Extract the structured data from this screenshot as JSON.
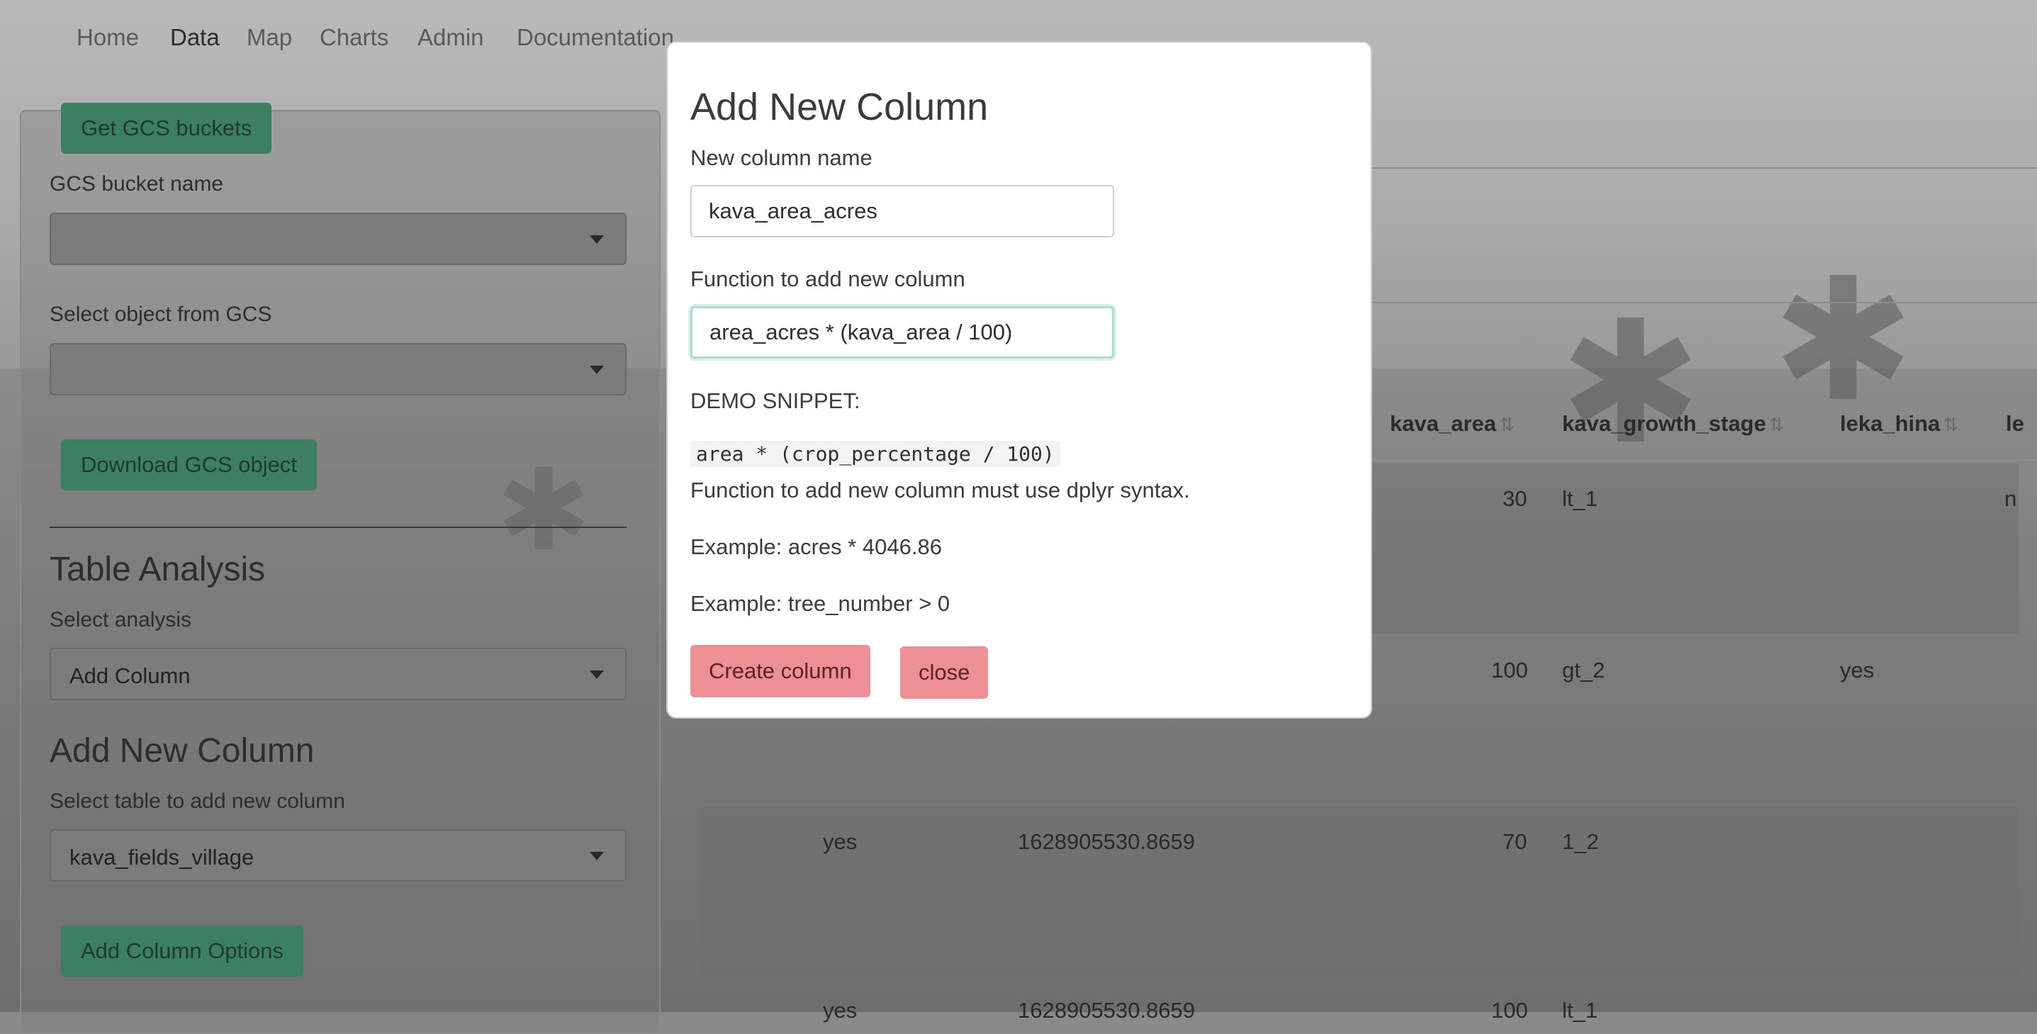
{
  "nav": {
    "items": [
      "Home",
      "Data",
      "Map",
      "Charts",
      "Admin",
      "Documentation"
    ],
    "active": "Data"
  },
  "sidebar": {
    "get_buckets_button": "Get GCS buckets",
    "bucket_label": "GCS bucket name",
    "bucket_value": "",
    "object_label": "Select object from GCS",
    "object_value": "",
    "download_button": "Download GCS object",
    "table_analysis_heading": "Table Analysis",
    "analysis_label": "Select analysis",
    "analysis_value": "Add Column",
    "add_column_heading": "Add New Column",
    "table_label": "Select table to add new column",
    "table_value": "kava_fields_village",
    "add_column_options_button": "Add Column Options"
  },
  "table": {
    "headers": [
      "kava_area",
      "kava_growth_stage",
      "leka_hina",
      "le"
    ],
    "rows": [
      {
        "c1": "",
        "c2": "",
        "kava_area": "30",
        "stage": "lt_1",
        "leka": "",
        "last": "n"
      },
      {
        "c1": "",
        "c2": "",
        "kava_area": "100",
        "stage": "gt_2",
        "leka": "yes",
        "last": ""
      },
      {
        "c1": "yes",
        "c2": "1628905530.8659",
        "kava_area": "70",
        "stage": "1_2",
        "leka": "",
        "last": ""
      },
      {
        "c1": "yes",
        "c2": "1628905530.8659",
        "kava_area": "100",
        "stage": "lt_1",
        "leka": "",
        "last": ""
      }
    ]
  },
  "modal": {
    "title": "Add New Column",
    "name_label": "New column name",
    "name_value": "kava_area_acres",
    "function_label": "Function to add new column",
    "function_value": "area_acres * (kava_area / 100)",
    "demo_label": "DEMO SNIPPET:",
    "demo_code": "area * (crop_percentage / 100)",
    "note": "Function to add new column must use dplyr syntax.",
    "example1": "Example: acres * 4046.86",
    "example2": "Example: tree_number > 0",
    "create_button": "Create column",
    "close_button": "close"
  },
  "colors": {
    "green_button": "#3d7f62",
    "pink_button": "#ee8f93",
    "focus_ring": "#a8ddd0"
  }
}
